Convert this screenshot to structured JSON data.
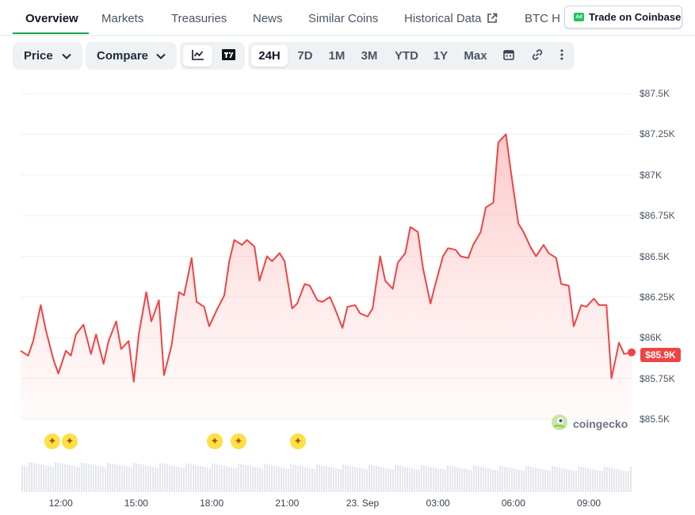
{
  "tabs": [
    {
      "label": "Overview",
      "active": true
    },
    {
      "label": "Markets"
    },
    {
      "label": "Treasuries"
    },
    {
      "label": "News"
    },
    {
      "label": "Similar Coins"
    },
    {
      "label": "Historical Data",
      "icon": "external-link-icon"
    },
    {
      "label": "BTC H"
    }
  ],
  "ad_button": {
    "badge": "Ad",
    "label": "Trade on Coinbase"
  },
  "toolbar": {
    "price_dropdown": "Price",
    "compare_dropdown": "Compare",
    "chart_type_icons": [
      "line-chart-icon",
      "tradingview-icon"
    ],
    "ranges": [
      "24H",
      "7D",
      "1M",
      "3M",
      "YTD",
      "1Y",
      "Max"
    ],
    "active_range": "24H",
    "tool_icons": [
      "calendar-icon",
      "link-icon",
      "more-icon"
    ]
  },
  "watermark": "coingecko",
  "current_price_label": "$85.9K",
  "colors": {
    "line": "#ef4444",
    "accent": "#16a34a",
    "star": "#fde047"
  },
  "chart_data": {
    "type": "area",
    "x_tick_labels": [
      "12:00",
      "15:00",
      "18:00",
      "21:00",
      "23. Sep",
      "03:00",
      "06:00",
      "09:00"
    ],
    "y_tick_labels": [
      "$87.5K",
      "$87.25K",
      "$87K",
      "$86.75K",
      "$86.5K",
      "$86.25K",
      "$86K",
      "$85.75K",
      "$85.5K"
    ],
    "ylim": [
      85500,
      87500
    ],
    "x_range_hours": [
      10.4,
      34.7
    ],
    "series": [
      {
        "x": [
          10.4,
          10.7,
          10.9,
          11.2,
          11.4,
          11.7,
          11.9,
          12.2,
          12.4,
          12.6,
          12.9,
          13.2,
          13.4,
          13.7,
          13.9,
          14.2,
          14.4,
          14.7,
          14.9,
          15.1,
          15.4,
          15.6,
          15.9,
          16.1,
          16.4,
          16.7,
          16.9,
          17.2,
          17.4,
          17.7,
          17.9,
          18.2,
          18.5,
          18.7,
          18.9,
          19.2,
          19.4,
          19.7,
          19.9,
          20.2,
          20.4,
          20.7,
          20.9,
          21.2,
          21.4,
          21.7,
          21.9,
          22.2,
          22.4,
          22.7,
          22.9,
          23.2,
          23.4,
          23.7,
          23.9,
          24.2,
          24.4,
          24.7,
          24.9,
          25.2,
          25.4,
          25.7,
          25.9,
          26.2,
          26.4,
          26.7,
          26.9,
          27.2,
          27.4,
          27.7,
          27.9,
          28.2,
          28.4,
          28.7,
          28.9,
          29.2,
          29.4,
          29.7,
          29.9,
          30.2,
          30.4,
          30.7,
          30.9,
          31.2,
          31.4,
          31.7,
          31.9,
          32.2,
          32.4,
          32.7,
          32.9,
          33.2,
          33.4,
          33.7,
          33.9,
          34.2,
          34.4,
          34.7
        ],
        "y": [
          85920,
          85890,
          85980,
          86200,
          86050,
          85870,
          85780,
          85920,
          85890,
          86020,
          86080,
          85900,
          86020,
          85840,
          85980,
          86100,
          85930,
          85980,
          85730,
          86020,
          86280,
          86100,
          86230,
          85770,
          85950,
          86280,
          86260,
          86490,
          86220,
          86190,
          86070,
          86170,
          86260,
          86470,
          86600,
          86570,
          86600,
          86560,
          86350,
          86500,
          86470,
          86520,
          86470,
          86180,
          86210,
          86330,
          86320,
          86230,
          86220,
          86250,
          86180,
          86060,
          86190,
          86200,
          86150,
          86130,
          86180,
          86500,
          86350,
          86300,
          86460,
          86520,
          86680,
          86650,
          86430,
          86210,
          86330,
          86500,
          86550,
          86540,
          86500,
          86490,
          86570,
          86650,
          86800,
          86830,
          87200,
          87250,
          87020,
          86700,
          86650,
          86550,
          86500,
          86570,
          86520,
          86490,
          86330,
          86320,
          86070,
          86200,
          86190,
          86240,
          86200,
          86200,
          85750,
          85970,
          85900,
          85910
        ]
      }
    ]
  }
}
